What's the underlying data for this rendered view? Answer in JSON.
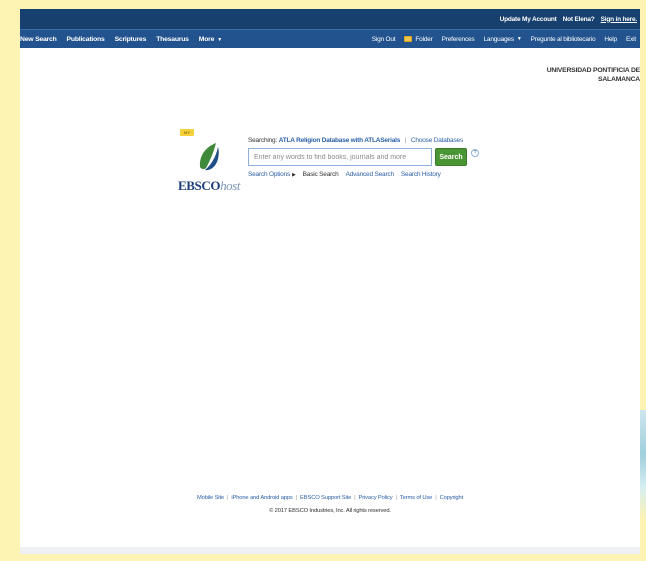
{
  "topbar": {
    "update_account": "Update My Account",
    "not_user": "Not Elena?",
    "sign_in": "Sign in here."
  },
  "navbar": {
    "left": [
      "New Search",
      "Publications",
      "Scriptures",
      "Thesaurus",
      "More"
    ],
    "right": {
      "sign_out": "Sign Out",
      "folder": "Folder",
      "preferences": "Preferences",
      "languages": "Languages",
      "librarian": "Pregunte al bibliotecario",
      "help": "Help",
      "exit": "Exit"
    }
  },
  "institution": {
    "line1": "UNIVERSIDAD PONTIFICIA DE",
    "line2": "SALAMANCA"
  },
  "logo": {
    "my_tag": "MY",
    "brand_bold": "EBSCO",
    "brand_italic": "host",
    "leaf_color": "#3f8a3a",
    "brand_color": "#1e3e7b"
  },
  "search": {
    "searching_label": "Searching:",
    "database": "ATLA Religion Database with ATLASerials",
    "choose_databases": "Choose Databases",
    "placeholder": "Enter any words to find books, journals and more",
    "button_label": "Search",
    "help_icon": "?",
    "links": {
      "options": "Search Options",
      "basic": "Basic Search",
      "advanced": "Advanced Search",
      "history": "Search History"
    }
  },
  "footer": {
    "links": [
      "Mobile Site",
      "iPhone and Android apps",
      "EBSCO Support Site",
      "Privacy Policy",
      "Terms of Use",
      "Copyright"
    ],
    "copyright": "© 2017 EBSCO Industries, Inc. All rights reserved."
  },
  "colors": {
    "topbar": "#17406e",
    "navbar": "#22538e",
    "search_button": "#4a9634",
    "link": "#2a5fa6",
    "background": "#fdf3b2"
  }
}
